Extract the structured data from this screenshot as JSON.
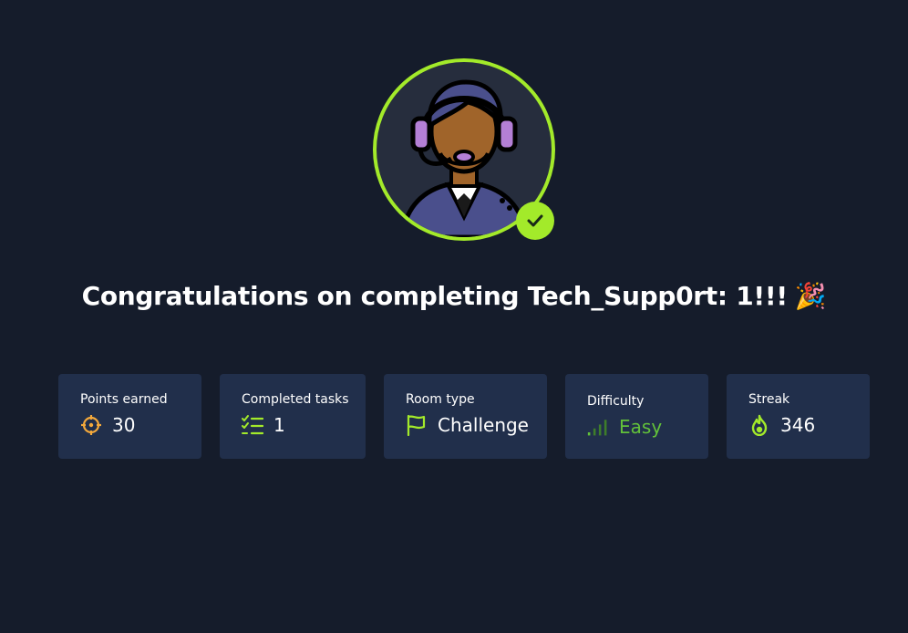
{
  "header": {
    "title": "Congratulations on completing Tech_Supp0rt: 1!!!",
    "celebration_emoji": "🎉"
  },
  "avatar": {
    "icon": "support-agent-icon",
    "badge_icon": "check-icon",
    "ring_color": "#a3ea2a"
  },
  "stats": [
    {
      "label": "Points earned",
      "value": "30",
      "icon": "crosshair-icon"
    },
    {
      "label": "Completed tasks",
      "value": "1",
      "icon": "checklist-icon"
    },
    {
      "label": "Room type",
      "value": "Challenge",
      "icon": "flag-icon"
    },
    {
      "label": "Difficulty",
      "value": "Easy",
      "icon": "signal-bars-icon",
      "color": "#62c13a"
    },
    {
      "label": "Streak",
      "value": "346",
      "icon": "flame-icon"
    }
  ],
  "colors": {
    "background": "#151c2b",
    "card": "#212f4b",
    "accent": "#a3ea2a",
    "points_icon": "#f4a93b",
    "easy": "#62c13a"
  }
}
